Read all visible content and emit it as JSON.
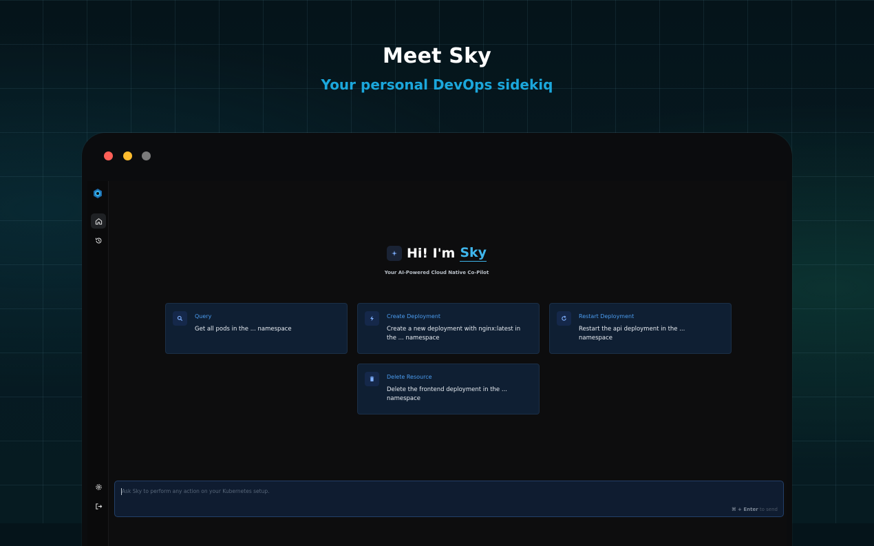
{
  "hero": {
    "title": "Meet Sky",
    "subtitle": "Your personal DevOps sidekiq"
  },
  "window_controls": [
    "close",
    "minimize",
    "zoom"
  ],
  "sidebar": {
    "logo": "sky-logo-icon",
    "nav": [
      {
        "name": "home",
        "icon": "home-icon",
        "active": true
      },
      {
        "name": "history",
        "icon": "history-icon",
        "active": false
      }
    ],
    "bottom": [
      {
        "name": "settings",
        "icon": "gear-icon"
      },
      {
        "name": "logout",
        "icon": "logout-icon"
      }
    ]
  },
  "main": {
    "greeting_prefix": "Hi! I'm",
    "greeting_name": "Sky",
    "tagline": "Your AI-Powered Cloud Native Co-Pilot",
    "cards": [
      {
        "title": "Query",
        "description": "Get all pods in the ... namespace",
        "icon": "search-icon"
      },
      {
        "title": "Create Deployment",
        "description": "Create a new deployment with nginx:latest in the ... namespace",
        "icon": "lightning-icon"
      },
      {
        "title": "Restart Deployment",
        "description": "Restart the api deployment in the ... namespace",
        "icon": "refresh-icon"
      },
      {
        "title": "Delete Resource",
        "description": "Delete the frontend deployment in the ... namespace",
        "icon": "trash-icon"
      }
    ]
  },
  "composer": {
    "placeholder": "Ask Sky to perform any action on your Kubernetes setup.",
    "value": "",
    "hint_keys": "⌘ + Enter",
    "hint_text": "to send"
  },
  "colors": {
    "accent": "#1ba7dc",
    "card_title": "#4b9cf0",
    "dot_red": "#ff5f57",
    "dot_yellow": "#febc2e",
    "dot_gray": "#7b7b7b"
  }
}
